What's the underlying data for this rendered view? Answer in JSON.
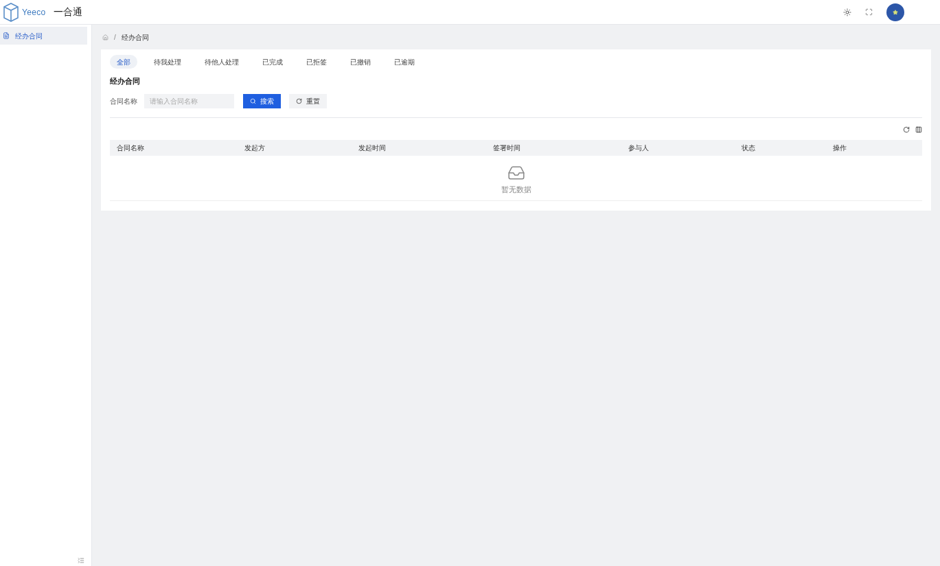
{
  "header": {
    "logo_text": "Yeeco",
    "app_name": "一合通"
  },
  "sidebar": {
    "items": [
      {
        "label": "经办合同",
        "selected": true
      }
    ]
  },
  "breadcrumb": [
    "经办合同"
  ],
  "breadcrumb_separator": "/",
  "tabs": [
    {
      "label": "全部",
      "selected": true
    },
    {
      "label": "待我处理",
      "selected": false
    },
    {
      "label": "待他人处理",
      "selected": false
    },
    {
      "label": "已完成",
      "selected": false
    },
    {
      "label": "已拒签",
      "selected": false
    },
    {
      "label": "已撤销",
      "selected": false
    },
    {
      "label": "已逾期",
      "selected": false
    }
  ],
  "section_title": "经办合同",
  "filter": {
    "label": "合同名称",
    "placeholder": "请输入合同名称",
    "search_button": "搜索",
    "reset_button": "重置"
  },
  "table": {
    "columns": [
      "合同名称",
      "发起方",
      "发起时间",
      "签署时间",
      "参与人",
      "状态",
      "操作"
    ],
    "empty_text": "暂无数据"
  }
}
